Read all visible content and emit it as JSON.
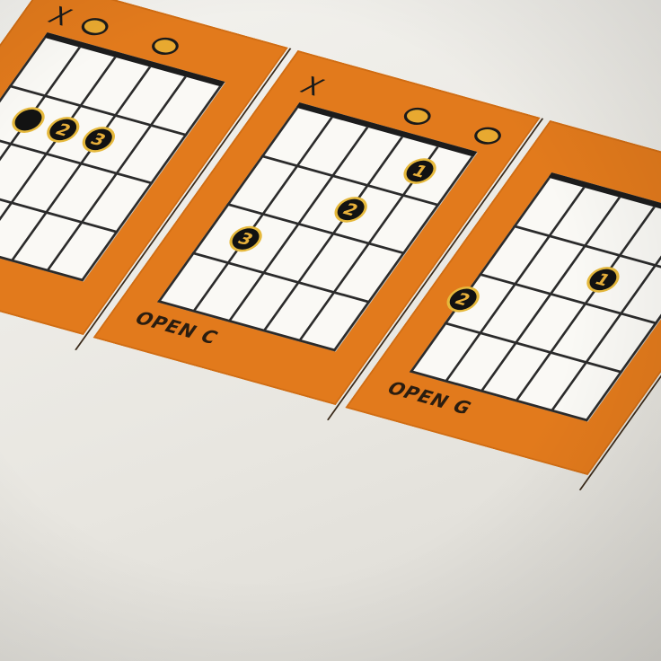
{
  "colors": {
    "card": "#e27a1c",
    "fretboard": "#faf9f5",
    "dot": "#121212",
    "dot_ring": "#e6b93c",
    "open_string": "#e8a930"
  },
  "chords": [
    {
      "name": "",
      "markers": [
        {
          "string": 1,
          "type": "mute",
          "symbol": "X"
        },
        {
          "string": 2,
          "type": "open"
        },
        {
          "string": 4,
          "type": "open"
        }
      ],
      "fingers": [
        {
          "string": 3,
          "fret": 2,
          "label": "2"
        },
        {
          "string": 4,
          "fret": 2,
          "label": "3"
        },
        {
          "string": 2,
          "fret": 2,
          "label": ""
        }
      ]
    },
    {
      "name": "OPEN C",
      "markers": [
        {
          "string": 1,
          "type": "mute",
          "symbol": "X"
        },
        {
          "string": 4,
          "type": "open"
        },
        {
          "string": 6,
          "type": "open"
        }
      ],
      "fingers": [
        {
          "string": 5,
          "fret": 1,
          "label": "1"
        },
        {
          "string": 4,
          "fret": 2,
          "label": "2"
        },
        {
          "string": 2,
          "fret": 3,
          "label": "3"
        }
      ]
    },
    {
      "name": "OPEN G",
      "markers": [],
      "fingers": [
        {
          "string": 4,
          "fret": 2,
          "label": "1"
        },
        {
          "string": 1,
          "fret": 3,
          "label": "2"
        }
      ]
    }
  ]
}
